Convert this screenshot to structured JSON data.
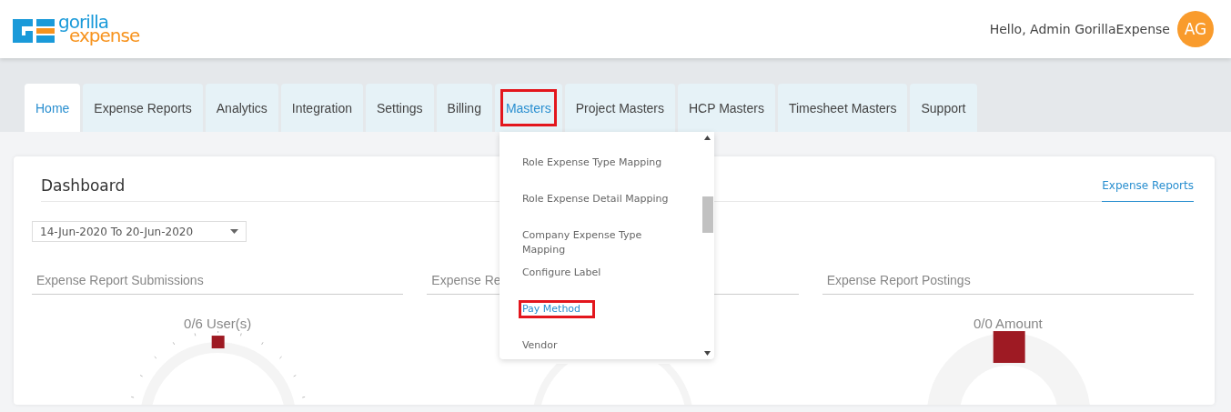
{
  "header": {
    "logo": {
      "word_1": "gorilla",
      "word_2": "expense"
    },
    "greeting": "Hello, Admin GorillaExpense",
    "avatar": "AG"
  },
  "tabs": [
    {
      "label": "Home",
      "selected": true,
      "open": false,
      "highlighted": false
    },
    {
      "label": "Expense Reports",
      "selected": false,
      "open": false,
      "highlighted": false
    },
    {
      "label": "Analytics",
      "selected": false,
      "open": false,
      "highlighted": false
    },
    {
      "label": "Integration",
      "selected": false,
      "open": false,
      "highlighted": false
    },
    {
      "label": "Settings",
      "selected": false,
      "open": false,
      "highlighted": false
    },
    {
      "label": "Billing",
      "selected": false,
      "open": false,
      "highlighted": false
    },
    {
      "label": "Masters",
      "selected": false,
      "open": true,
      "highlighted": true
    },
    {
      "label": "Project Masters",
      "selected": false,
      "open": false,
      "highlighted": false
    },
    {
      "label": "HCP Masters",
      "selected": false,
      "open": false,
      "highlighted": false
    },
    {
      "label": "Timesheet Masters",
      "selected": false,
      "open": false,
      "highlighted": false
    },
    {
      "label": "Support",
      "selected": false,
      "open": false,
      "highlighted": false
    }
  ],
  "menu": {
    "items": [
      {
        "label": "Role Expense Type Mapping",
        "highlighted": false
      },
      {
        "label": "Role Expense Detail Mapping",
        "highlighted": false
      },
      {
        "label": "Company Expense Type Mapping",
        "highlighted": false
      },
      {
        "label": "Configure Label",
        "highlighted": false
      },
      {
        "label": "Pay Method",
        "highlighted": true
      },
      {
        "label": "Vendor",
        "highlighted": false
      }
    ]
  },
  "dashboard": {
    "title": "Dashboard",
    "link": "Expense Reports",
    "date_range": "14-Jun-2020 To 20-Jun-2020",
    "panels": [
      {
        "title": "Expense Report Submissions",
        "reading": "0/6 User(s)",
        "kind": "ticked"
      },
      {
        "title": "Expense Re",
        "kind": "plain"
      },
      {
        "title": "Expense Report Postings",
        "reading": "0/0 Amount",
        "kind": "donut"
      }
    ]
  }
}
